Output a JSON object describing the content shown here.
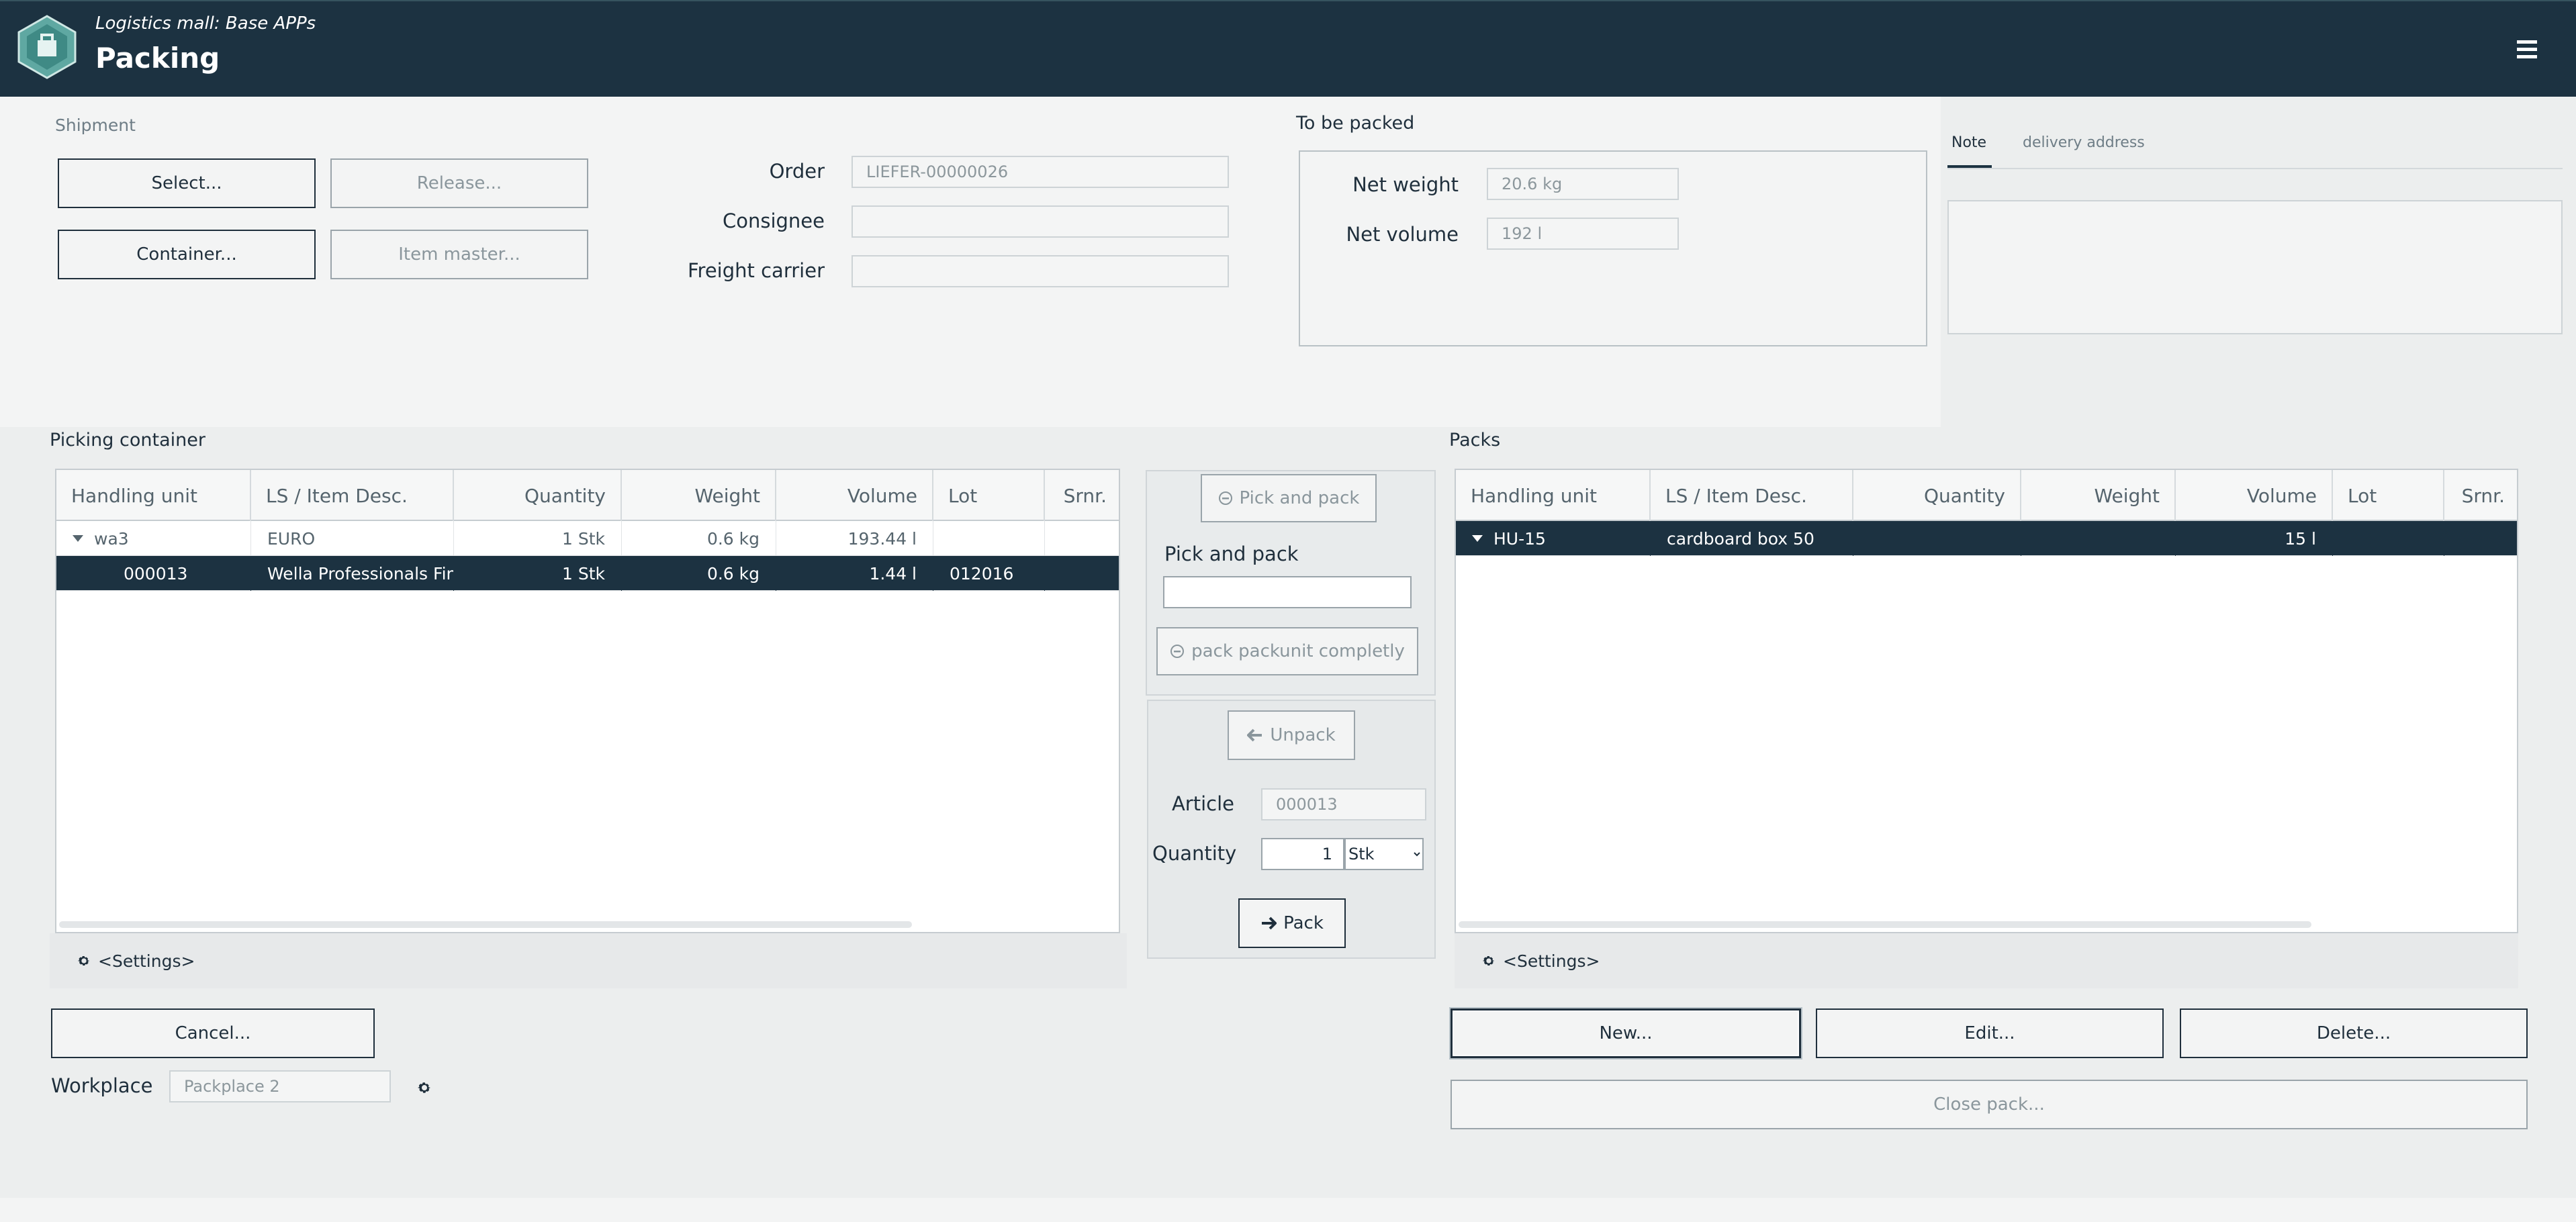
{
  "header": {
    "subtitle": "Logistics mall: Base APPs",
    "title": "Packing"
  },
  "shipment": {
    "section_label": "Shipment",
    "select_label": "Select...",
    "release_label": "Release...",
    "container_label": "Container...",
    "item_master_label": "Item master...",
    "order_label": "Order",
    "order_value": "LIEFER-00000026",
    "consignee_label": "Consignee",
    "consignee_value": "",
    "carrier_label": "Freight carrier",
    "carrier_value": ""
  },
  "to_be_packed": {
    "title": "To be packed",
    "net_weight_label": "Net weight",
    "net_weight_value": "20.6 kg",
    "net_volume_label": "Net volume",
    "net_volume_value": "192 l"
  },
  "note_tabs": {
    "note": "Note",
    "delivery": "delivery address",
    "note_text": ""
  },
  "picking": {
    "title": "Picking container",
    "columns": [
      "Handling unit",
      "LS / Item Desc.",
      "Quantity",
      "Weight",
      "Volume",
      "Lot",
      "Srnr."
    ],
    "rows": [
      {
        "hu": "wa3",
        "desc": "EURO",
        "qty": "1 Stk",
        "weight": "0.6 kg",
        "volume": "193.44 l",
        "lot": "",
        "srnr": ""
      },
      {
        "hu": "000013",
        "desc": "Wella Professionals Finisl",
        "qty": "1 Stk",
        "weight": "0.6 kg",
        "volume": "1.44 l",
        "lot": "012016",
        "srnr": ""
      }
    ],
    "settings": "<Settings>"
  },
  "center": {
    "pick_and_pack_btn": "Pick and pack",
    "pick_and_pack_label": "Pick and pack",
    "pick_and_pack_value": "",
    "pack_completely_btn": "pack packunit completly",
    "unpack_btn": "Unpack",
    "article_label": "Article",
    "article_value": "000013",
    "quantity_label": "Quantity",
    "quantity_value": "1",
    "unit_options": [
      "Stk"
    ],
    "pack_btn": "Pack"
  },
  "packs": {
    "title": "Packs",
    "columns": [
      "Handling unit",
      "LS / Item Desc.",
      "Quantity",
      "Weight",
      "Volume",
      "Lot",
      "Srnr."
    ],
    "rows": [
      {
        "hu": "HU-15",
        "desc": "cardboard box 50",
        "qty": "",
        "weight": "",
        "volume": "15 l",
        "lot": "",
        "srnr": ""
      }
    ],
    "settings": "<Settings>"
  },
  "bottom": {
    "cancel_label": "Cancel...",
    "workplace_label": "Workplace",
    "workplace_value": "Packplace 2",
    "new_label": "New...",
    "edit_label": "Edit...",
    "delete_label": "Delete...",
    "close_pack_label": "Close pack..."
  },
  "colors": {
    "header_bg": "#1c3241",
    "selected_row": "#1c3241",
    "accent": "#1f2f3c"
  },
  "icons": [
    "app-logo-icon",
    "hamburger-menu-icon",
    "gear-icon",
    "minus-circle-icon",
    "arrow-left-icon",
    "arrow-right-icon",
    "caret-down-icon"
  ]
}
